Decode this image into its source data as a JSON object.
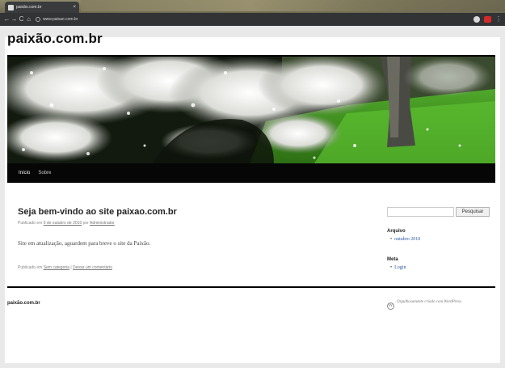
{
  "browser": {
    "tab_title": "paixão.com.br",
    "tab_close": "×",
    "url": "www.paixao.com.br",
    "back": "←",
    "forward": "→",
    "reload": "C",
    "home": "⌂",
    "menu": "⋮"
  },
  "site": {
    "title": "paixão.com.br",
    "nav": [
      {
        "label": "Início"
      },
      {
        "label": "Sobre"
      }
    ]
  },
  "post": {
    "title": "Seja bem-vindo ao site paixao.com.br",
    "meta_prefix": "Publicado em",
    "date": "9 de outubro de 2010",
    "meta_by": "por",
    "author": "Administrador",
    "content": "Site em atualização, aguardem para breve o site da Paixão.",
    "footer_prefix": "Publicado em",
    "category": "Sem categoria",
    "separator": "|",
    "comment_link": "Deixar um comentário"
  },
  "sidebar": {
    "search_button": "Pesquisar",
    "archives_title": "Arquivo",
    "archives": [
      "outubro 2010"
    ],
    "meta_title": "Meta",
    "meta_links": [
      "Login"
    ]
  },
  "footer": {
    "site_name": "paixão.com.br",
    "credit": "Orgulhosamente criado com WordPress.",
    "wp_glyph": "W"
  },
  "colors": {
    "link": "#2855a4",
    "nav_bg": "#060606"
  }
}
